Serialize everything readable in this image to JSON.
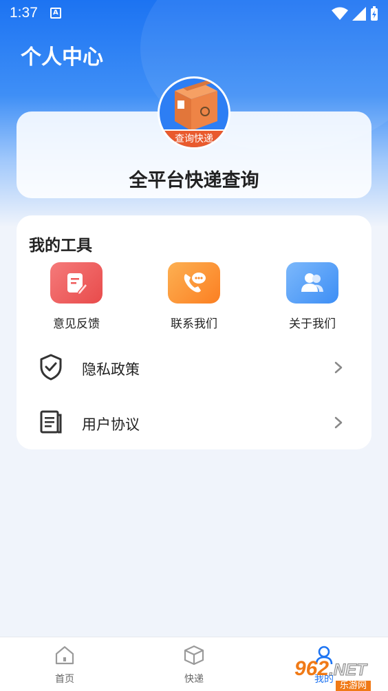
{
  "status_bar": {
    "time": "1:37",
    "notification_icon": "A"
  },
  "header": {
    "title": "个人中心"
  },
  "brand": {
    "name": "全平台快递查询",
    "logo_banner": "查询快递",
    "logo_icon": "package-box-icon"
  },
  "tools": {
    "title": "我的工具",
    "items": [
      {
        "label": "意见反馈",
        "icon": "feedback-icon",
        "color": "#ef5a5a"
      },
      {
        "label": "联系我们",
        "icon": "phone-chat-icon",
        "color": "#fb8b2a"
      },
      {
        "label": "关于我们",
        "icon": "people-icon",
        "color": "#3d8ef5"
      }
    ]
  },
  "menu": {
    "items": [
      {
        "label": "隐私政策",
        "icon": "shield-check-icon"
      },
      {
        "label": "用户协议",
        "icon": "document-icon"
      }
    ]
  },
  "tabbar": {
    "items": [
      {
        "label": "首页",
        "icon": "home-icon"
      },
      {
        "label": "快递",
        "icon": "box-icon"
      },
      {
        "label": "我的",
        "icon": "user-icon"
      }
    ]
  },
  "watermark": {
    "brand": "962",
    "suffix": ".NET",
    "caption": "乐游网"
  },
  "colors": {
    "primary_blue": "#1c73f2",
    "background": "#f0f4fb"
  }
}
